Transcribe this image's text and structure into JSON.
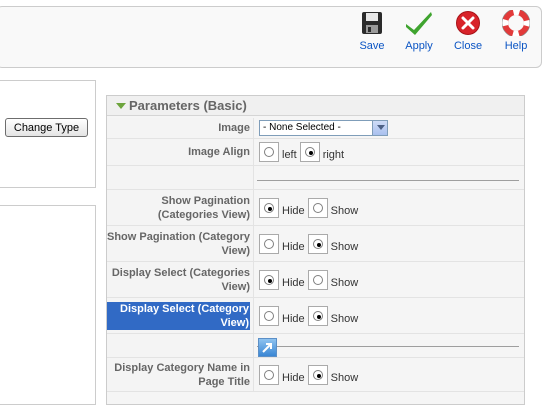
{
  "toolbar": {
    "save_label": "Save",
    "apply_label": "Apply",
    "close_label": "Close",
    "help_label": "Help"
  },
  "left": {
    "change_type_label": "Change Type"
  },
  "params": {
    "title": "Parameters (Basic)",
    "image_label": "Image",
    "image_value": "- None Selected -",
    "image_align_label": "Image Align",
    "align_left": "left",
    "align_right": "right",
    "show_pag_cats_label": "Show Pagination (Categories View)",
    "show_pag_cat_label": "Show Pagination (Category View)",
    "display_select_cats_label": "Display Select (Categories View)",
    "display_select_cat_label": "Display Select (Category View)",
    "display_cat_name_label": "Display Category Name in Page Title",
    "hide": "Hide",
    "show": "Show"
  },
  "colors": {
    "link_blue": "#0b55c4",
    "panel_bg": "#f5f5f5",
    "selection": "#316ac5",
    "toggle_green": "#6da43d"
  }
}
